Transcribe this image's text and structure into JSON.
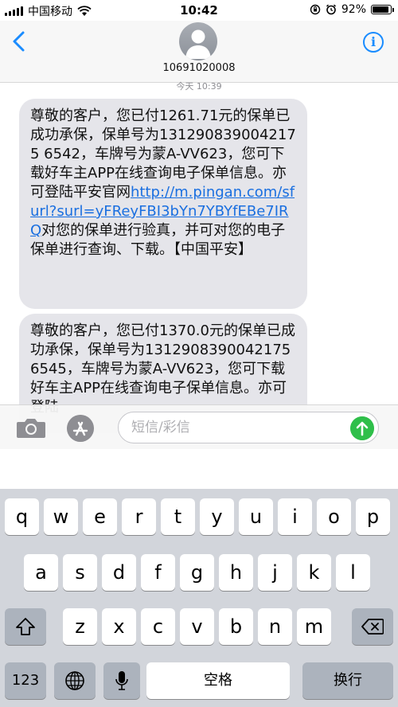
{
  "status_bar": {
    "carrier": "中国移动",
    "time": "10:42",
    "battery": "92%",
    "battery_level": 0.92
  },
  "header": {
    "contact_number": "10691020008"
  },
  "conversation": {
    "timestamp": "今天 10:39",
    "messages": [
      {
        "text_before_link": "尊敬的客户，您已付1261.71元的保单已成功承保，保单号为1312908390042175 6542，车牌号为蒙A-VV623，您可下载好车主APP在线查询电子保单信息。亦可登陆平安官网",
        "link": "http://m.pingan.com/sfurl?surl=yFReyFBI3bYn7YBYfEBe7IRQ",
        "text_after_link": "对您的保单进行验真，并可对您的电子保单进行查询、下载。【中国平安】"
      },
      {
        "text": "尊敬的客户，您已付1370.0元的保单已成功承保，保单号为13129083900421756545，车牌号为蒙A-VV623，您可下载好车主APP在线查询电子保单信息。亦可登陆"
      }
    ]
  },
  "input_bar": {
    "placeholder": "短信/彩信"
  },
  "keyboard": {
    "row1": [
      "q",
      "w",
      "e",
      "r",
      "t",
      "y",
      "u",
      "i",
      "o",
      "p"
    ],
    "row2": [
      "a",
      "s",
      "d",
      "f",
      "g",
      "h",
      "j",
      "k",
      "l"
    ],
    "row3": [
      "z",
      "x",
      "c",
      "v",
      "b",
      "n",
      "m"
    ],
    "numbers_label": "123",
    "space_label": "空格",
    "return_label": "换行"
  }
}
